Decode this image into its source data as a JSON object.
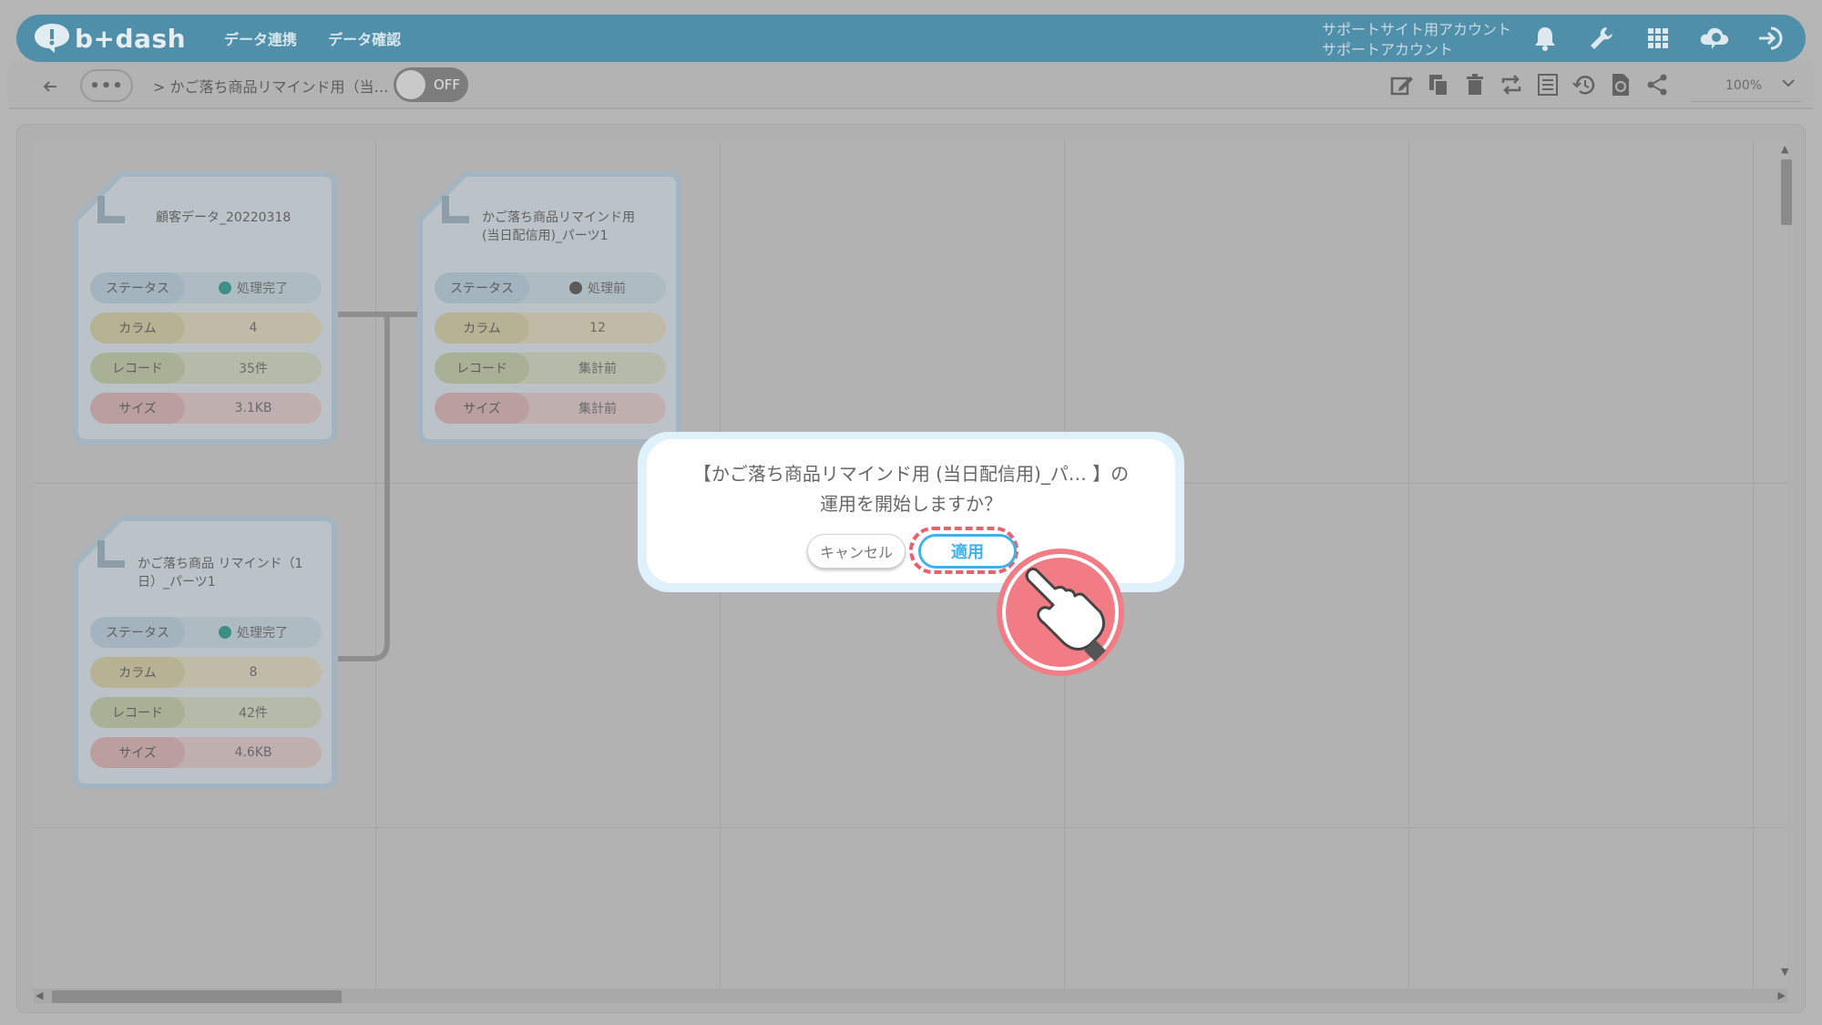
{
  "header": {
    "logo_text": "b+dash",
    "nav": [
      "データ連携",
      "データ確認"
    ],
    "account_line1": "サポートサイト用アカウント",
    "account_line2": "サポートアカウント",
    "icons": [
      "bell-icon",
      "wrench-icon",
      "grid-icon",
      "cloud-badge-icon",
      "logout-icon"
    ],
    "accent_color": "#4f8fa9"
  },
  "toolbar": {
    "dots": "•••",
    "breadcrumb": "> かご落ち商品リマインド用（当…",
    "toggle_label": "OFF",
    "tools": [
      "edit-icon",
      "copy-icon",
      "trash-icon",
      "repeat-icon",
      "table-icon",
      "history-icon",
      "refresh-doc-icon",
      "share-icon"
    ],
    "zoom": "100%"
  },
  "cards": [
    {
      "title": "顧客データ_20220318",
      "rows": [
        {
          "label": "ステータス",
          "value": "処理完了",
          "status": "done"
        },
        {
          "label": "カラム",
          "value": "4"
        },
        {
          "label": "レコード",
          "value": "35件"
        },
        {
          "label": "サイズ",
          "value": "3.1KB"
        }
      ]
    },
    {
      "title": "かご落ち商品リマインド用（当日配信用）_パーツ1",
      "title_line1": "かご落ち商品リマインド用",
      "title_line2": "(当日配信用)_パーツ1",
      "rows": [
        {
          "label": "ステータス",
          "value": "処理前",
          "status": "pending"
        },
        {
          "label": "カラム",
          "value": "12"
        },
        {
          "label": "レコード",
          "value": "集計前"
        },
        {
          "label": "サイズ",
          "value": "集計前"
        }
      ]
    },
    {
      "title_line1": "かご落ち商品 リマインド（1",
      "title_line2": "日）_パーツ1",
      "rows": [
        {
          "label": "ステータス",
          "value": "処理完了",
          "status": "done"
        },
        {
          "label": "カラム",
          "value": "8"
        },
        {
          "label": "レコード",
          "value": "42件"
        },
        {
          "label": "サイズ",
          "value": "4.6KB"
        }
      ]
    }
  ],
  "dialog": {
    "line1": "【かご落ち商品リマインド用 (当日配信用)_パ… 】の",
    "line2": "運用を開始しますか？",
    "cancel": "キャンセル",
    "apply": "適用",
    "apply_color": "#3fb2ea",
    "highlight_color": "#ee5f6e"
  }
}
